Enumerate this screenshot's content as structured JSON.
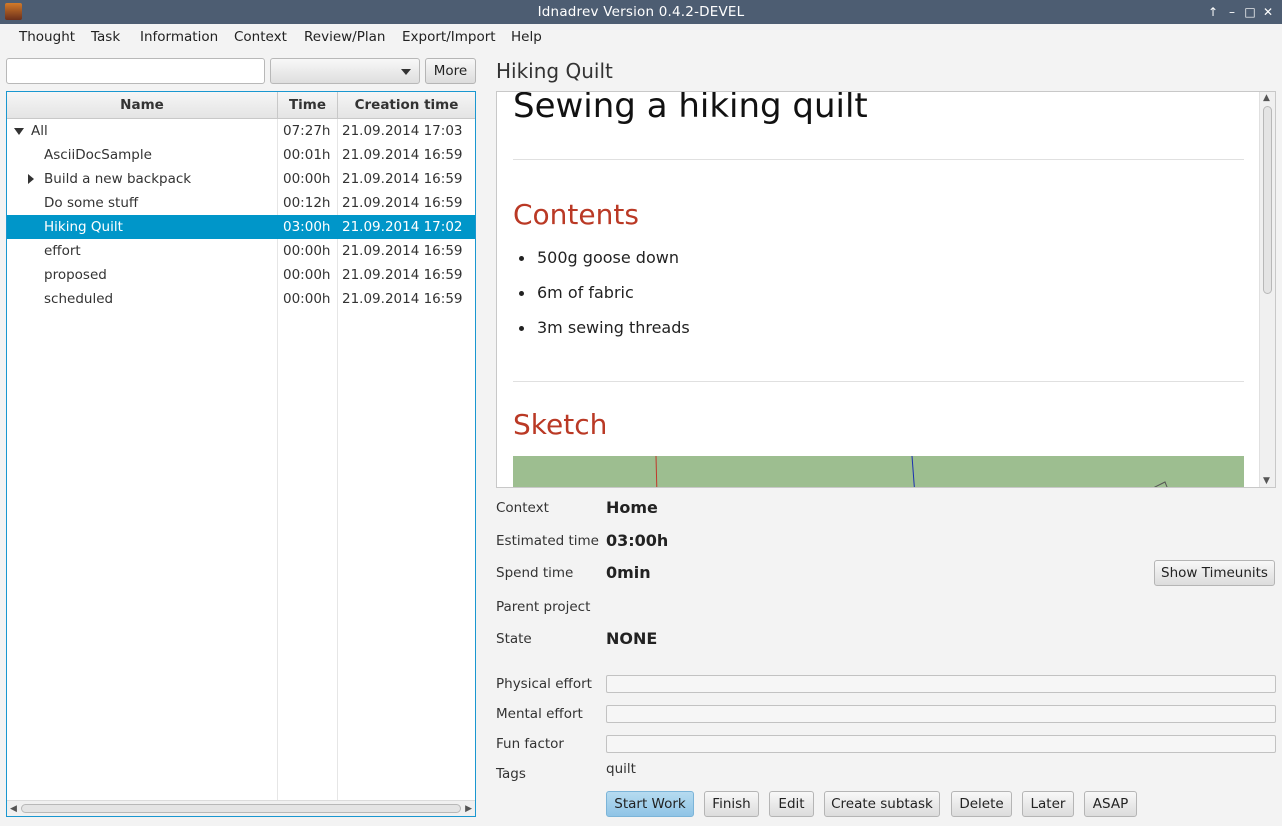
{
  "window": {
    "title": "Idnadrev Version 0.4.2-DEVEL",
    "controls": [
      "↑",
      "–",
      "□",
      "✕"
    ]
  },
  "menu": [
    "Thought",
    "Task",
    "Information",
    "Context",
    "Review/Plan",
    "Export/Import",
    "Help"
  ],
  "search": {
    "value": "",
    "filter_value": "",
    "more_label": "More"
  },
  "tree": {
    "columns": [
      "Name",
      "Time",
      "Creation time"
    ],
    "rows": [
      {
        "name": "All",
        "time": "07:27h",
        "created": "21.09.2014 17:03",
        "expanded": true,
        "selected": false
      },
      {
        "name": "AsciiDocSample",
        "time": "00:01h",
        "created": "21.09.2014 16:59",
        "selected": false
      },
      {
        "name": "Build a new backpack",
        "time": "00:00h",
        "created": "21.09.2014 16:59",
        "collapsed": true,
        "selected": false
      },
      {
        "name": "Do some stuff",
        "time": "00:12h",
        "created": "21.09.2014 16:59",
        "selected": false
      },
      {
        "name": "Hiking Quilt",
        "time": "03:00h",
        "created": "21.09.2014 17:02",
        "selected": true
      },
      {
        "name": "effort",
        "time": "00:00h",
        "created": "21.09.2014 16:59",
        "selected": false
      },
      {
        "name": "proposed",
        "time": "00:00h",
        "created": "21.09.2014 16:59",
        "selected": false
      },
      {
        "name": "scheduled",
        "time": "00:00h",
        "created": "21.09.2014 16:59",
        "selected": false
      }
    ]
  },
  "detail": {
    "title": "Hiking Quilt",
    "document": {
      "heading": "Sewing a hiking quilt",
      "sections": [
        {
          "title": "Contents",
          "items": [
            "500g goose down",
            "6m of fabric",
            "3m sewing threads"
          ]
        },
        {
          "title": "Sketch"
        }
      ]
    },
    "properties": {
      "context_label": "Context",
      "context_value": "Home",
      "estimated_label": "Estimated time",
      "estimated_value": "03:00h",
      "spend_label": "Spend time",
      "spend_value": "0min",
      "parent_label": "Parent project",
      "parent_value": "",
      "state_label": "State",
      "state_value": "NONE",
      "physical_label": "Physical effort",
      "physical_value": 0,
      "mental_label": "Mental effort",
      "mental_value": 0,
      "fun_label": "Fun factor",
      "fun_value": 0,
      "tags_label": "Tags",
      "tags_value": "quilt"
    },
    "show_timeunits_label": "Show Timeunits",
    "actions": [
      "Start Work",
      "Finish",
      "Edit",
      "Create subtask",
      "Delete",
      "Later",
      "ASAP"
    ]
  },
  "colors": {
    "selection": "#0096c9",
    "heading": "#ba3925",
    "titlebar": "#4d5d72"
  }
}
